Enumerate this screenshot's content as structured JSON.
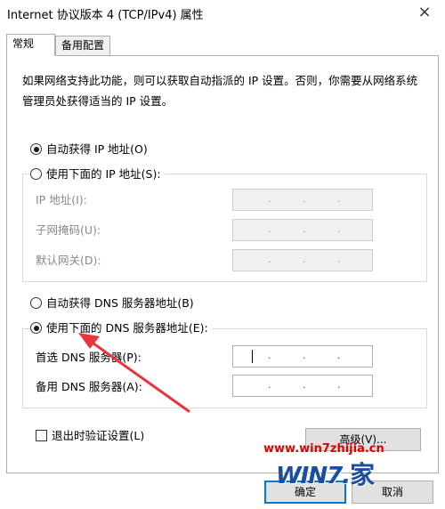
{
  "window": {
    "title": "Internet 协议版本 4 (TCP/IPv4) 属性",
    "close_glyph": "×"
  },
  "tabs": [
    {
      "label": "常规",
      "active": true
    },
    {
      "label": "备用配置",
      "active": false
    }
  ],
  "description": "如果网络支持此功能，则可以获取自动指派的 IP 设置。否则，你需要从网络系统管理员处获得适当的 IP 设置。",
  "ip": {
    "auto_label": "自动获得 IP 地址(O)",
    "auto_selected": true,
    "manual_label": "使用下面的 IP 地址(S):",
    "manual_selected": false,
    "fields": [
      {
        "label": "IP 地址(I):",
        "value": ""
      },
      {
        "label": "子网掩码(U):",
        "value": ""
      },
      {
        "label": "默认网关(D):",
        "value": ""
      }
    ]
  },
  "dns": {
    "auto_label": "自动获得 DNS 服务器地址(B)",
    "auto_selected": false,
    "manual_label": "使用下面的 DNS 服务器地址(E):",
    "manual_selected": true,
    "fields": [
      {
        "label": "首选 DNS 服务器(P):",
        "value": ""
      },
      {
        "label": "备用 DNS 服务器(A):",
        "value": ""
      }
    ]
  },
  "validate": {
    "label": "退出时验证设置(L)",
    "checked": false
  },
  "buttons": {
    "advanced": "高级(V)...",
    "ok": "确定",
    "cancel": "取消"
  },
  "watermark": {
    "url": "www.win7zhijia.cn",
    "logo": "WIN7.",
    "logo_char": "家"
  },
  "colors": {
    "annotation_arrow": "#e8363c",
    "ok_border": "#0078d7",
    "watermark_red": "#e00000",
    "watermark_blue": "#1b4ea0"
  }
}
